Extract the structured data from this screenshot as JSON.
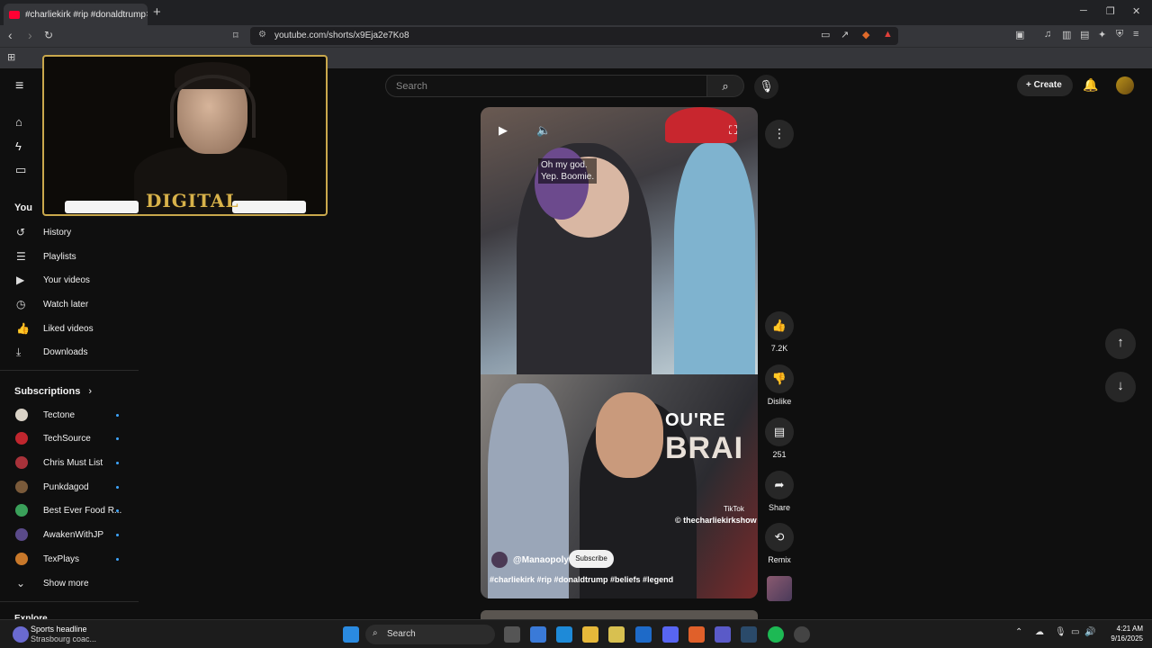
{
  "browser": {
    "tab_title": "#charliekirk #rip #donaldtrump",
    "tab_close": "×",
    "new_tab": "+",
    "url": "youtube.com/shorts/x9Eja2e7Ko8"
  },
  "header": {
    "search_placeholder": "Search",
    "create_label": "Create"
  },
  "sidebar": {
    "you_label": "You",
    "you_items": [
      {
        "label": "History",
        "icon": "history-icon"
      },
      {
        "label": "Playlists",
        "icon": "playlists-icon"
      },
      {
        "label": "Your videos",
        "icon": "your-videos-icon"
      },
      {
        "label": "Watch later",
        "icon": "watch-later-icon"
      },
      {
        "label": "Liked videos",
        "icon": "liked-videos-icon"
      },
      {
        "label": "Downloads",
        "icon": "downloads-icon"
      }
    ],
    "subscriptions_label": "Subscriptions",
    "subscriptions": [
      {
        "label": "Tectone",
        "color": "#d9d2c6"
      },
      {
        "label": "TechSource",
        "color": "#c0262e"
      },
      {
        "label": "Chris Must List",
        "color": "#a8323a"
      },
      {
        "label": "Punkdagod",
        "color": "#7a5a3a"
      },
      {
        "label": "Best Ever Food R...",
        "color": "#3aa05a"
      },
      {
        "label": "AwakenWithJP",
        "color": "#5a4a8a"
      },
      {
        "label": "TexPlays",
        "color": "#c8782a"
      }
    ],
    "show_more": "Show more",
    "explore_label": "Explore"
  },
  "webcam": {
    "brand": "DIGITAL"
  },
  "short": {
    "caption_line1": "Oh my god.",
    "caption_line2": "Yep. Boomie.",
    "sign_text": "OU'RE",
    "sign_text2": "BRAI",
    "watermark": "© thecharliekirkshow",
    "tiktok": "TikTok",
    "channel": "@Manaopoly",
    "subscribe": "Subscribe",
    "title": "#charliekirk #rip #donaldtrump #beliefs #legend"
  },
  "actions": {
    "likes": "7.2K",
    "dislike": "Dislike",
    "comments": "251",
    "share": "Share",
    "remix": "Remix"
  },
  "taskbar": {
    "news_title": "Sports headline",
    "news_sub": "Strasbourg coac...",
    "search": "Search",
    "time": "4:21 AM",
    "date": "9/16/2025"
  },
  "colors": {
    "accent": "#3ea6ff",
    "youtube_red": "#ff0033",
    "webcam_border": "#c9a84c"
  }
}
